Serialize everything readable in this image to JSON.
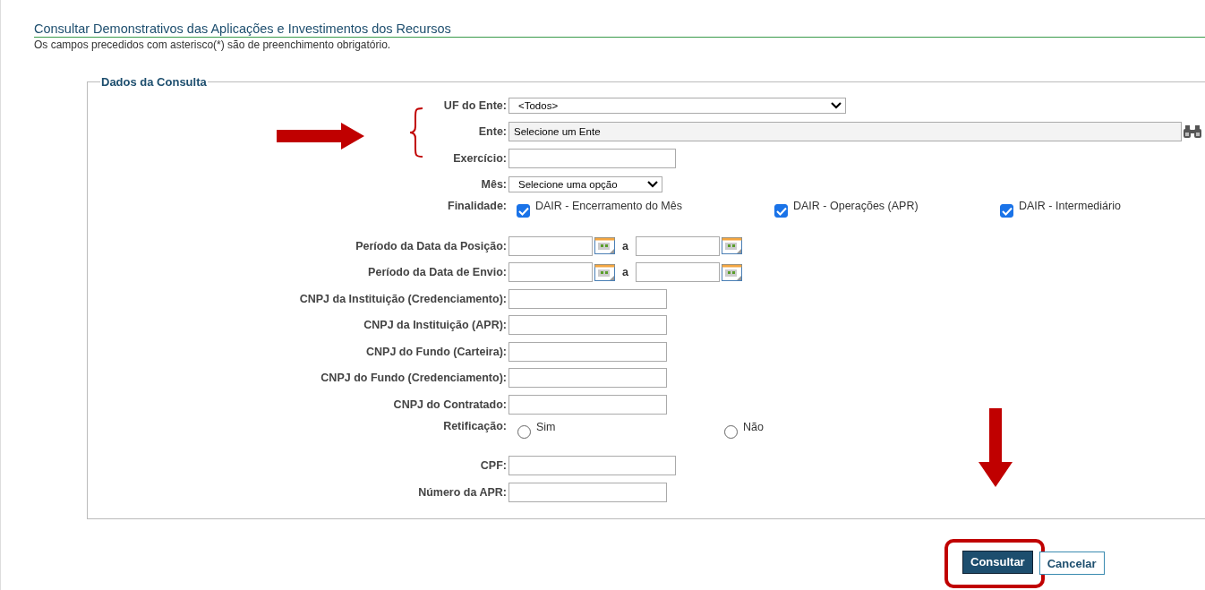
{
  "page": {
    "title": "Consultar Demonstrativos das Aplicações e Investimentos dos Recursos",
    "note": "Os campos precedidos com asterisco(*) são de preenchimento obrigatório."
  },
  "fieldset": {
    "legend": "Dados da Consulta",
    "fields": [
      {
        "kind": "select",
        "label": "UF do Ente:",
        "value": "<Todos>"
      },
      {
        "kind": "lookup",
        "label": "Ente:",
        "value": "Selecione um Ente"
      },
      {
        "kind": "text",
        "label": "Exercício:"
      },
      {
        "kind": "select",
        "label": "Mês:",
        "value": "Selecione uma opção"
      },
      {
        "kind": "checkboxes",
        "label": "Finalidade:",
        "options": [
          {
            "label": "DAIR - Encerramento do Mês",
            "checked": true
          },
          {
            "label": "DAIR - Operações (APR)",
            "checked": true
          },
          {
            "label": "DAIR - Intermediário",
            "checked": true
          }
        ]
      },
      {
        "kind": "daterange",
        "label": "Período da Data da Posição:",
        "separator": "a"
      },
      {
        "kind": "daterange",
        "label": "Período da Data de Envio:",
        "separator": "a"
      },
      {
        "kind": "text",
        "label": "CNPJ da Instituição (Credenciamento):"
      },
      {
        "kind": "text",
        "label": "CNPJ da Instituição (APR):"
      },
      {
        "kind": "text",
        "label": "CNPJ do Fundo (Carteira):"
      },
      {
        "kind": "text",
        "label": "CNPJ do Fundo (Credenciamento):"
      },
      {
        "kind": "text",
        "label": "CNPJ do Contratado:"
      },
      {
        "kind": "radios",
        "label": "Retificação:",
        "options": [
          {
            "label": "Sim",
            "selected": false
          },
          {
            "label": "Não",
            "selected": false
          }
        ]
      },
      {
        "kind": "text",
        "label": "CPF:"
      },
      {
        "kind": "text",
        "label": "Número da APR:"
      }
    ]
  },
  "buttons": [
    {
      "label": "Consultar",
      "kind": "primary",
      "highlighted": true
    },
    {
      "label": "Cancelar",
      "kind": "secondary",
      "highlighted": false
    }
  ]
}
